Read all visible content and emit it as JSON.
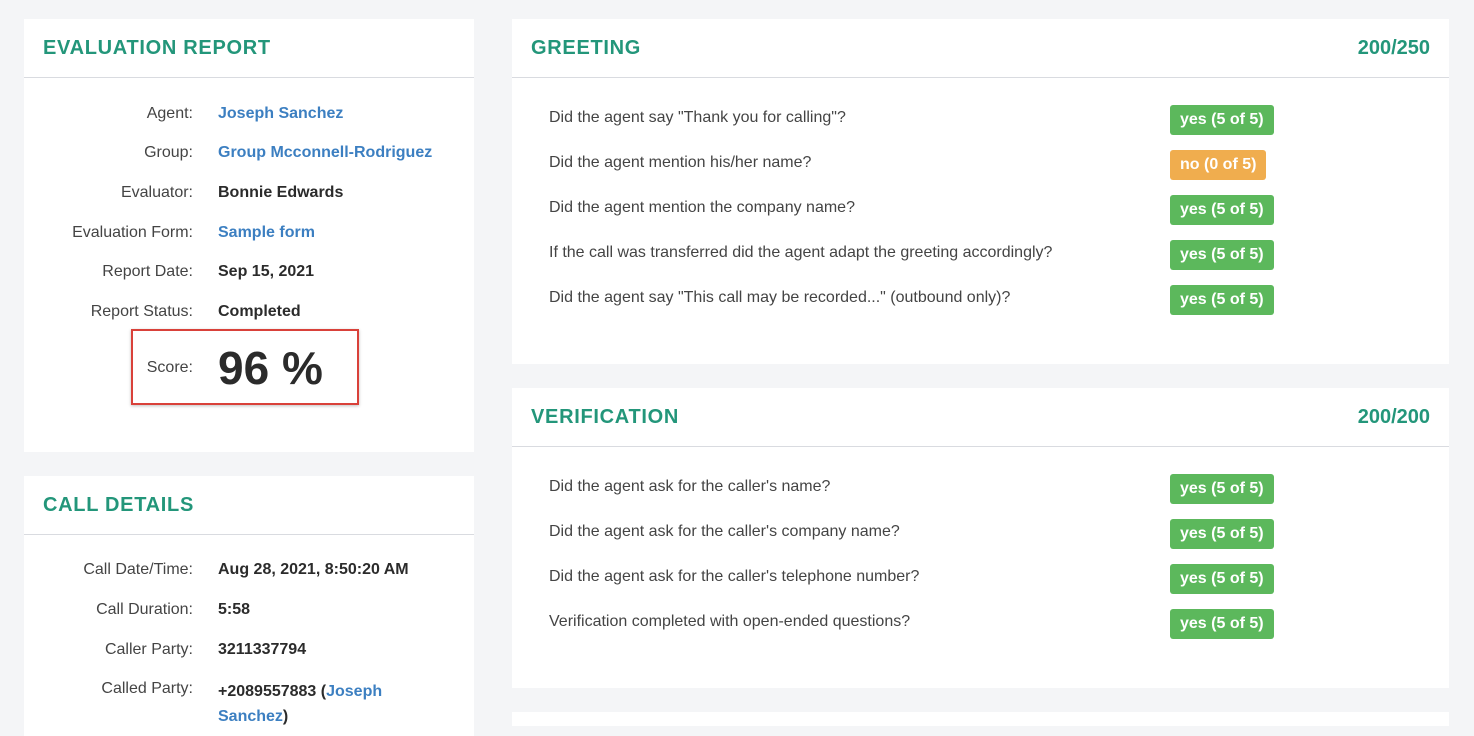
{
  "evaluation_report": {
    "title": "EVALUATION  REPORT",
    "agent_label": "Agent:",
    "agent_value": "Joseph Sanchez",
    "group_label": "Group:",
    "group_value": "Group Mcconnell-Rodriguez",
    "evaluator_label": "Evaluator:",
    "evaluator_value": "Bonnie Edwards",
    "form_label": "Evaluation Form:",
    "form_value": "Sample form",
    "date_label": "Report Date:",
    "date_value": "Sep 15, 2021",
    "status_label": "Report Status:",
    "status_value": "Completed",
    "score_label": "Score:",
    "score_value": "96 %"
  },
  "call_details": {
    "title": "CALL  DETAILS",
    "datetime_label": "Call Date/Time:",
    "datetime_value": "Aug 28, 2021, 8:50:20 AM",
    "duration_label": "Call Duration:",
    "duration_value": "5:58",
    "caller_label": "Caller Party:",
    "caller_value": "3211337794",
    "called_label": "Called Party:",
    "called_number": "+2089557883 (",
    "called_name_first": "Joseph",
    "called_name_last": "Sanchez",
    "called_close": ")"
  },
  "greeting": {
    "title": "GREETING",
    "score": "200/250",
    "questions": [
      {
        "text": "Did the agent say \"Thank you for calling\"?",
        "answer": "yes (5 of 5)",
        "status": "yes"
      },
      {
        "text": "Did the agent mention his/her name?",
        "answer": "no (0 of 5)",
        "status": "no"
      },
      {
        "text": "Did the agent mention the company name?",
        "answer": "yes (5 of 5)",
        "status": "yes"
      },
      {
        "text": "If the call was transferred did the agent adapt the greeting accordingly?",
        "answer": "yes (5 of 5)",
        "status": "yes"
      },
      {
        "text": "Did the agent say \"This call may be recorded...\" (outbound only)?",
        "answer": "yes (5 of 5)",
        "status": "yes"
      }
    ]
  },
  "verification": {
    "title": "VERIFICATION",
    "score": "200/200",
    "questions": [
      {
        "text": "Did the agent ask for the caller's name?",
        "answer": "yes (5 of 5)",
        "status": "yes"
      },
      {
        "text": "Did the agent ask for the caller's company name?",
        "answer": "yes (5 of 5)",
        "status": "yes"
      },
      {
        "text": "Did the agent ask for the caller's telephone number?",
        "answer": "yes (5 of 5)",
        "status": "yes"
      },
      {
        "text": "Verification completed with open-ended questions?",
        "answer": "yes (5 of 5)",
        "status": "yes"
      }
    ]
  },
  "colors": {
    "accent": "#23967a",
    "link": "#3c7fc1",
    "badge_yes": "#5cb85c",
    "badge_no": "#f0ad4e",
    "highlight_border": "#d9413a"
  }
}
